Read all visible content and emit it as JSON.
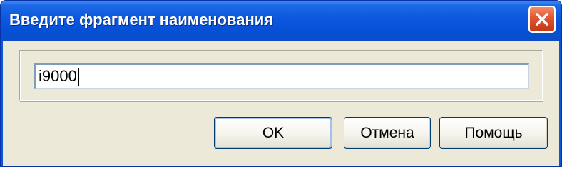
{
  "window": {
    "title": "Введите фрагмент наименования",
    "close_icon": "close-icon"
  },
  "form": {
    "search_value": "i9000"
  },
  "buttons": {
    "ok_label": "OK",
    "cancel_label": "Отмена",
    "help_label": "Помощь"
  },
  "colors": {
    "titlebar": "#0a58df",
    "client_background": "#ece9d8",
    "close_button": "#e2532f",
    "button_border": "#003c74"
  }
}
